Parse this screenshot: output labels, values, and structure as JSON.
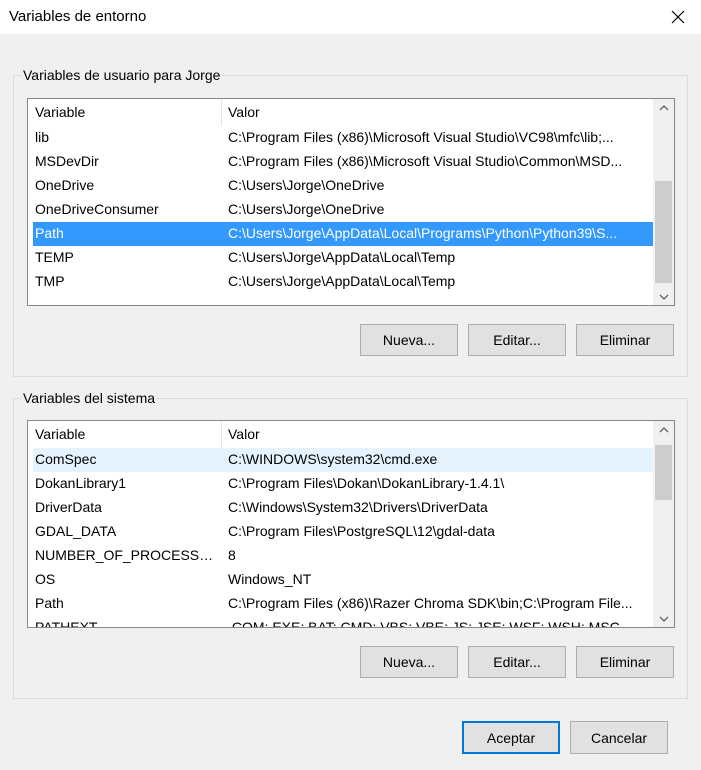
{
  "window": {
    "title": "Variables de entorno"
  },
  "user_section": {
    "label": "Variables de usuario para Jorge",
    "columns": {
      "variable": "Variable",
      "value": "Valor"
    },
    "rows": [
      {
        "name": "lib",
        "value": "C:\\Program Files (x86)\\Microsoft Visual Studio\\VC98\\mfc\\lib;..."
      },
      {
        "name": "MSDevDir",
        "value": "C:\\Program Files (x86)\\Microsoft Visual Studio\\Common\\MSD..."
      },
      {
        "name": "OneDrive",
        "value": "C:\\Users\\Jorge\\OneDrive"
      },
      {
        "name": "OneDriveConsumer",
        "value": "C:\\Users\\Jorge\\OneDrive"
      },
      {
        "name": "Path",
        "value": "C:\\Users\\Jorge\\AppData\\Local\\Programs\\Python\\Python39\\S..."
      },
      {
        "name": "TEMP",
        "value": "C:\\Users\\Jorge\\AppData\\Local\\Temp"
      },
      {
        "name": "TMP",
        "value": "C:\\Users\\Jorge\\AppData\\Local\\Temp"
      }
    ],
    "selected_row": 4,
    "buttons": {
      "new": "Nueva...",
      "edit": "Editar...",
      "delete": "Eliminar"
    }
  },
  "system_section": {
    "label": "Variables del sistema",
    "columns": {
      "variable": "Variable",
      "value": "Valor"
    },
    "rows": [
      {
        "name": "ComSpec",
        "value": "C:\\WINDOWS\\system32\\cmd.exe"
      },
      {
        "name": "DokanLibrary1",
        "value": "C:\\Program Files\\Dokan\\DokanLibrary-1.4.1\\"
      },
      {
        "name": "DriverData",
        "value": "C:\\Windows\\System32\\Drivers\\DriverData"
      },
      {
        "name": "GDAL_DATA",
        "value": "C:\\Program Files\\PostgreSQL\\12\\gdal-data"
      },
      {
        "name": "NUMBER_OF_PROCESSORS",
        "value": "8"
      },
      {
        "name": "OS",
        "value": "Windows_NT"
      },
      {
        "name": "Path",
        "value": "C:\\Program Files (x86)\\Razer Chroma SDK\\bin;C:\\Program File..."
      },
      {
        "name": "PATHEXT",
        "value": ".COM;.EXE;.BAT;.CMD;.VBS;.VBE;.JS;.JSE;.WSF;.WSH;.MSC"
      }
    ],
    "highlighted_row": 0,
    "buttons": {
      "new": "Nueva...",
      "edit": "Editar...",
      "delete": "Eliminar"
    }
  },
  "footer": {
    "ok": "Aceptar",
    "cancel": "Cancelar"
  },
  "colors": {
    "selection": "#3399ff",
    "accent": "#0078d7",
    "hover": "#e5f3ff"
  },
  "icons": {
    "close": "close-icon",
    "scroll_up": "chevron-up-icon",
    "scroll_down": "chevron-down-icon"
  }
}
